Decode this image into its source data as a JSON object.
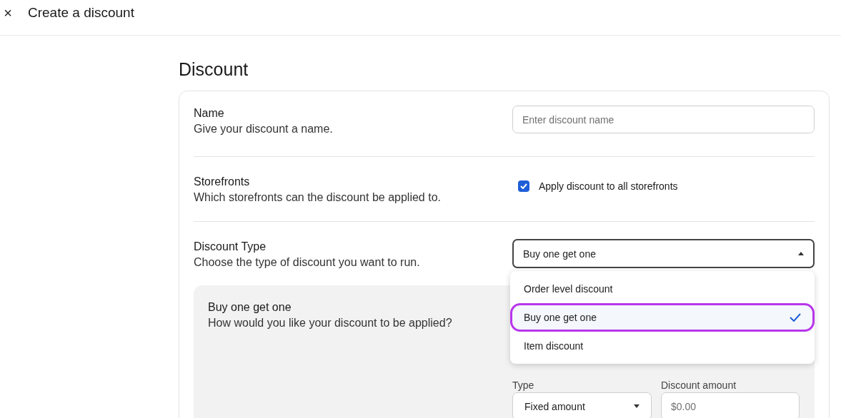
{
  "header": {
    "close_icon": "×",
    "title": "Create a discount"
  },
  "heading": "Discount",
  "sections": [
    {
      "kind": "text",
      "title": "Name",
      "description": "Give your discount a name.",
      "placeholder": "Enter discount name"
    },
    {
      "kind": "checkbox",
      "title": "Storefronts",
      "description": "Which storefronts can the discount be applied to.",
      "label": "Apply discount to all storefronts",
      "checked": true
    },
    {
      "kind": "select",
      "title": "Discount Type",
      "description": "Choose the type of discount you want to run.",
      "value": "Buy one get one",
      "expanded": true,
      "options": [
        {
          "label": "Order level discount",
          "selected": false
        },
        {
          "label": "Buy one get one",
          "selected": true
        },
        {
          "label": "Item discount",
          "selected": false
        }
      ]
    }
  ],
  "panel": {
    "title": "Buy one get one",
    "description": "How would you like your discount to be applied?",
    "fields": [
      {
        "kind": "select",
        "label": "Type",
        "value": "Fixed amount",
        "expanded": false
      },
      {
        "kind": "text",
        "label": "Discount amount",
        "placeholder": "$0.00"
      }
    ]
  }
}
